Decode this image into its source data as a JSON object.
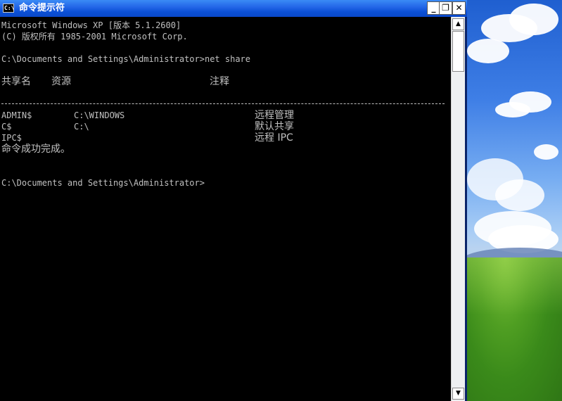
{
  "window": {
    "title": "命令提示符",
    "icon_text": "C:\\"
  },
  "titlebar_buttons": {
    "minimize": "_",
    "maximize": "❐",
    "close": "✕"
  },
  "console": {
    "line1": "Microsoft Windows XP [版本 5.1.2600]",
    "line2": "(C) 版权所有 1985-2001 Microsoft Corp.",
    "command": "C:\\Documents and Settings\\Administrator>net share",
    "header_share": "共享名",
    "header_resource": "资源",
    "header_remark": "注释",
    "separator": "-------------------------------------------------------------------------------",
    "rows": [
      {
        "name": "ADMIN$",
        "resource": "C:\\WINDOWS",
        "remark": "远程管理"
      },
      {
        "name": "C$",
        "resource": "C:\\",
        "remark": "默认共享"
      },
      {
        "name": "IPC$",
        "resource": "",
        "remark": "远程 IPC"
      }
    ],
    "result": "命令成功完成。",
    "prompt": "C:\\Documents and Settings\\Administrator>"
  },
  "scrollbar": {
    "up_arrow": "▲",
    "down_arrow": "▼"
  }
}
